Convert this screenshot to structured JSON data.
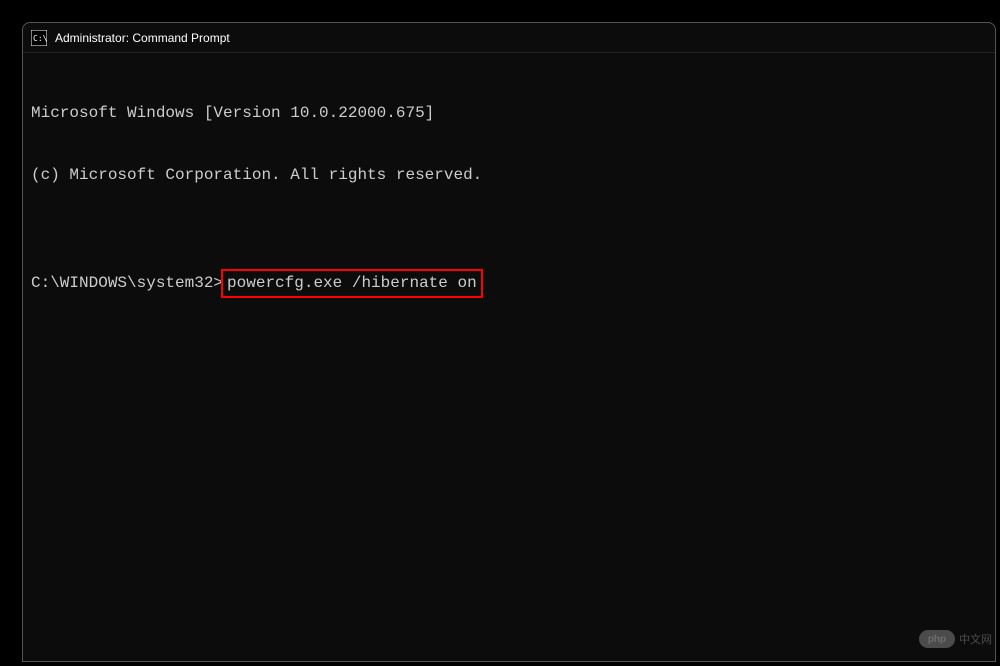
{
  "window": {
    "title": "Administrator: Command Prompt"
  },
  "terminal": {
    "line1": "Microsoft Windows [Version 10.0.22000.675]",
    "line2": "(c) Microsoft Corporation. All rights reserved.",
    "blank": "",
    "prompt": "C:\\WINDOWS\\system32>",
    "command": "powercfg.exe /hibernate on"
  },
  "watermark": {
    "logo": "php",
    "text": "中文网"
  }
}
